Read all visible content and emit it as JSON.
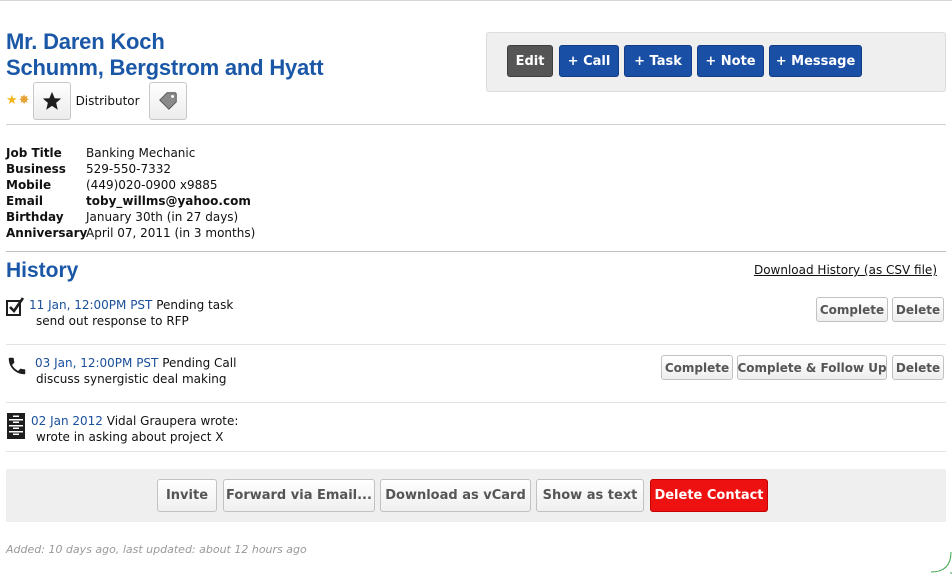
{
  "contact": {
    "name": "Mr. Daren Koch",
    "company": "Schumm, Bergstrom and Hyatt",
    "tag": "Distributor",
    "badge_icons": [
      "star-icon",
      "rosette-icon"
    ]
  },
  "actions": {
    "edit": "Edit",
    "call": "+ Call",
    "task": "+ Task",
    "note": "+ Note",
    "message": "+ Message"
  },
  "fields": [
    {
      "label": "Job Title",
      "value": "Banking Mechanic"
    },
    {
      "label": "Business",
      "value": "529-550-7332"
    },
    {
      "label": "Mobile",
      "value": "(449)020-0900 x9885"
    },
    {
      "label": "Email",
      "value": "toby_willms@yahoo.com"
    },
    {
      "label": "Birthday",
      "value": "January 30th (in 27 days)"
    },
    {
      "label": "Anniversary",
      "value": "April 07, 2011 (in 3 months)"
    }
  ],
  "history": {
    "title": "History",
    "download_link": "Download History (as CSV file)",
    "items": [
      {
        "icon": "checkbox-icon",
        "date": "11 Jan, 12:00PM PST",
        "kind": "Pending task",
        "text": "send out response to RFP",
        "buttons": [
          "Complete",
          "Delete"
        ]
      },
      {
        "icon": "phone-icon",
        "date": "03 Jan, 12:00PM PST",
        "kind": "Pending Call",
        "text": "discuss synergistic deal making",
        "buttons": [
          "Complete",
          "Complete & Follow Up",
          "Delete"
        ]
      },
      {
        "icon": "filing-cabinet-icon",
        "date": "02 Jan 2012",
        "kind": "Vidal Graupera wrote:",
        "text": "wrote in asking about project X",
        "buttons": []
      }
    ]
  },
  "footer": {
    "invite": "Invite",
    "forward": "Forward via Email...",
    "vcard": "Download as vCard",
    "show_text": "Show as text",
    "delete": "Delete Contact",
    "added": "Added: 10 days ago, last updated: about 12 hours ago"
  },
  "colors": {
    "brand_blue": "#1a57a6",
    "button_blue": "#1a4fa6",
    "danger_red": "#ee1111"
  }
}
